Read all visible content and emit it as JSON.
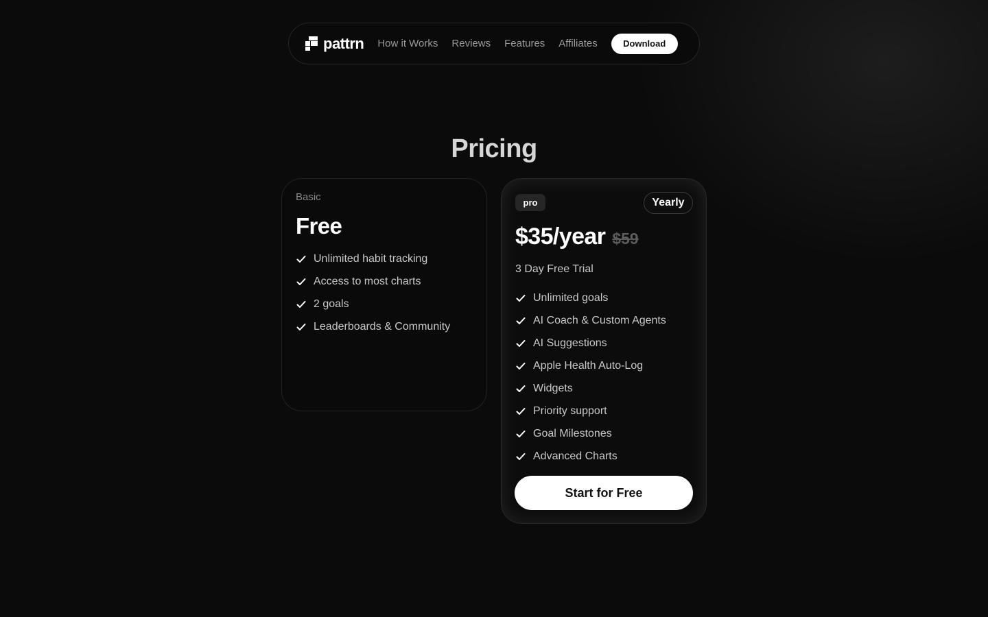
{
  "nav": {
    "logo_text": "pattrn",
    "links": [
      "How it Works",
      "Reviews",
      "Features",
      "Affiliates"
    ],
    "download_label": "Download"
  },
  "title": "Pricing",
  "basic": {
    "label": "Basic",
    "price": "Free",
    "features": [
      "Unlimited habit tracking",
      "Access to most charts",
      "2 goals",
      "Leaderboards & Community"
    ]
  },
  "pro": {
    "badge": "pro",
    "billing": "Yearly",
    "price": "$35/year",
    "old_price": "$59",
    "trial": "3 Day Free Trial",
    "features": [
      "Unlimited goals",
      "AI Coach & Custom Agents",
      "AI Suggestions",
      "Apple Health Auto-Log",
      "Widgets",
      "Priority support",
      "Goal Milestones",
      "Advanced Charts"
    ],
    "cta_label": "Start for Free"
  },
  "icons": {
    "feature": "check-icon",
    "logo": "pattrn-logo-icon"
  },
  "colors": {
    "background": "#0b0b0b",
    "accent": "#ffffff",
    "muted_text": "#9a9a9a"
  }
}
